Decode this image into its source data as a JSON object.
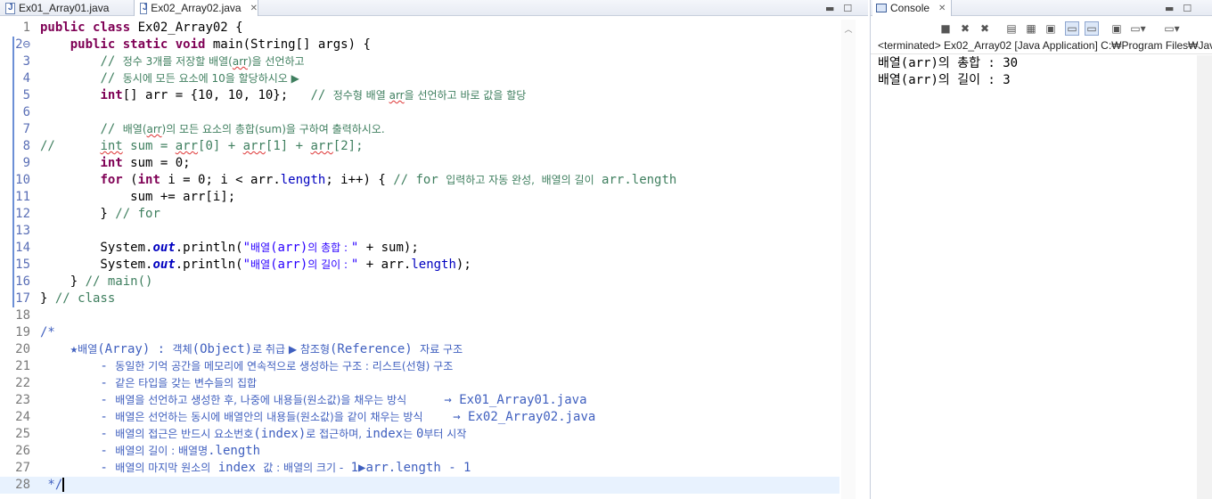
{
  "editor": {
    "tabs": [
      {
        "label": "Ex01_Array01.java",
        "active": false
      },
      {
        "label": "Ex02_Array02.java",
        "active": true
      }
    ],
    "lines": [
      {
        "n": "1",
        "mark": "",
        "html": "<span class='kw'>public class</span> Ex02_Array02 {"
      },
      {
        "n": "2",
        "mark": "⊖",
        "html": "    <span class='kw'>public static void</span> main(String[] args) {"
      },
      {
        "n": "3",
        "mark": "",
        "html": "        <span class='cm'>// <span class='ko'>정수 3개를 저장할 배열(<span class='sq'>arr</span>)을 선언하고</span></span>"
      },
      {
        "n": "4",
        "mark": "",
        "html": "        <span class='cm'>// <span class='ko'>동시에 모든 요소에 10을 할당하시오 ▶</span></span>"
      },
      {
        "n": "5",
        "mark": "",
        "html": "        <span class='kw'>int</span>[] arr = {10, 10, 10};   <span class='cm'>// <span class='ko'>정수형 배열 <span class='sq'>arr</span>을 선언하고 바로 값을 할당</span></span>"
      },
      {
        "n": "6",
        "mark": "",
        "html": ""
      },
      {
        "n": "7",
        "mark": "",
        "html": "        <span class='cm'>// <span class='ko'>배열(<span class='sq'>arr</span>)의 모든 요소의 총합(sum)을 구하여 출력하시오.</span></span>"
      },
      {
        "n": "8",
        "mark": "",
        "html": "<span class='cm'>//      <span class='sq'>int</span> sum = <span class='sq'>arr</span>[0] + <span class='sq'>arr</span>[1] + <span class='sq'>arr</span>[2];</span>"
      },
      {
        "n": "9",
        "mark": "",
        "html": "        <span class='kw'>int</span> sum = 0;"
      },
      {
        "n": "10",
        "mark": "",
        "html": "        <span class='kw'>for</span> (<span class='kw'>int</span> i = 0; i &lt; arr.<span style='color:#0000c0'>length</span>; i++) { <span class='cm'>// for <span class='ko'>입력하고 자동 완성,  배열의 길이</span> arr.length</span>"
      },
      {
        "n": "11",
        "mark": "",
        "html": "            sum += arr[i];"
      },
      {
        "n": "12",
        "mark": "",
        "html": "        } <span class='cm'>// for</span>"
      },
      {
        "n": "13",
        "mark": "",
        "html": ""
      },
      {
        "n": "14",
        "mark": "",
        "html": "        System.<span class='fd'>out</span>.println(<span class='st'>\"<span class='ko'>배열</span>(arr)<span class='ko'>의 총합 : </span>\"</span> + sum);"
      },
      {
        "n": "15",
        "mark": "",
        "html": "        System.<span class='fd'>out</span>.println(<span class='st'>\"<span class='ko'>배열</span>(arr)<span class='ko'>의 길이 : </span>\"</span> + arr.<span style='color:#0000c0'>length</span>);"
      },
      {
        "n": "16",
        "mark": "",
        "html": "    } <span class='cm'>// main()</span>"
      },
      {
        "n": "17",
        "mark": "",
        "html": "} <span class='cm'>// class</span>"
      },
      {
        "n": "18",
        "mark": "",
        "html": ""
      },
      {
        "n": "19",
        "mark": "",
        "html": "<span class='jd'>/*</span>"
      },
      {
        "n": "20",
        "mark": "",
        "html": "<span class='jd'>    ★<span class='ko'>배열</span>(Array) : <span class='ko'>객체</span>(Object)<span class='ko'>로 취급 ▶ 참조형</span>(Reference) <span class='ko'>자료 구조</span></span>"
      },
      {
        "n": "21",
        "mark": "",
        "html": "<span class='jd'>        - <span class='ko'>동일한 기억 공간을 메모리에 연속적으로 생성하는 구조 : 리스트(선형) 구조</span></span>"
      },
      {
        "n": "22",
        "mark": "",
        "html": "<span class='jd'>        - <span class='ko'>같은 타입을 갖는 변수들의 집합</span></span>"
      },
      {
        "n": "23",
        "mark": "",
        "html": "<span class='jd'>        - <span class='ko'>배열을 선언하고 생성한 후, 나중에 내용들(원소값)을 채우는 방식</span>     → Ex01_Array01.java</span>"
      },
      {
        "n": "24",
        "mark": "",
        "html": "<span class='jd'>        - <span class='ko'>배열은 선언하는 동시에 배열안의 내용들(원소값)을 같이 채우는 방식</span>    → Ex02_Array02.java</span>"
      },
      {
        "n": "25",
        "mark": "",
        "html": "<span class='jd'>        - <span class='ko'>배열의 접근은 반드시 요소번호</span>(index)<span class='ko'>로 접근하며, </span>index<span class='ko'>는 </span>0<span class='ko'>부터 시작</span></span>"
      },
      {
        "n": "26",
        "mark": "",
        "html": "<span class='jd'>        - <span class='ko'>배열의 길이 : 배열명</span>.length</span>"
      },
      {
        "n": "27",
        "mark": "",
        "html": "<span class='jd'>        - <span class='ko'>배열의 마지막 원소의</span> index <span class='ko'>값 : 배열의 크기 -</span> 1▶arr.length - 1</span>"
      },
      {
        "n": "28",
        "mark": "",
        "html": "<span class='jd'> */</span><span class='caret'></span>"
      }
    ]
  },
  "console": {
    "tab_label": "Console",
    "status": "<terminated> Ex02_Array02 [Java Application] C:₩Program Files₩Jav",
    "output": [
      "배열(arr)의 총합 : 30",
      "배열(arr)의 길이 : 3"
    ],
    "toolbar_icons": [
      "terminate-icon",
      "remove-launch-icon",
      "remove-all-icon",
      "scroll-lock-icon",
      "word-wrap-icon",
      "show-stdout-icon",
      "show-stderr-icon",
      "pin-console-icon",
      "display-console-icon",
      "open-console-icon"
    ]
  }
}
